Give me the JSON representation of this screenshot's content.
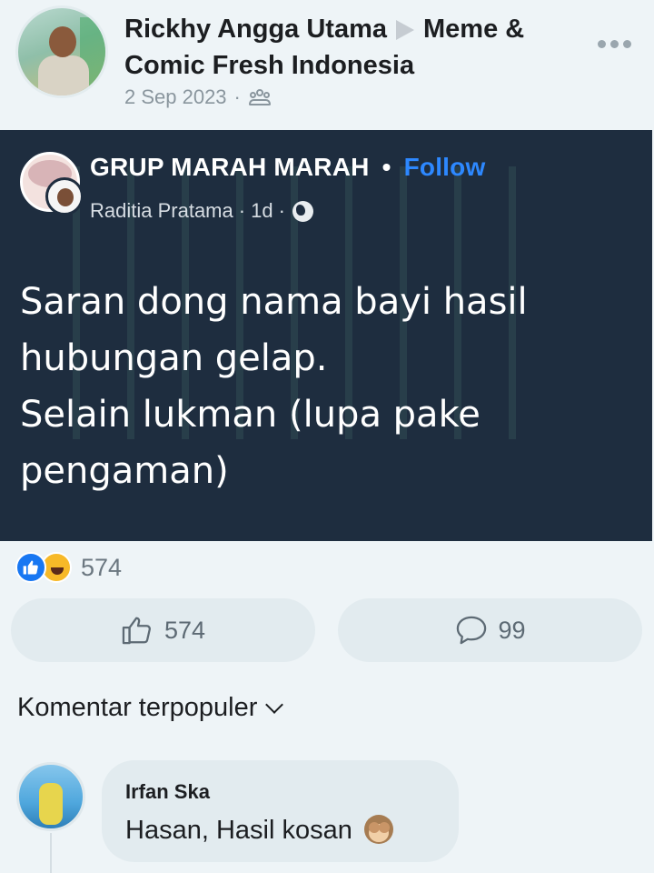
{
  "post": {
    "author": "Rickhy Angga Utama",
    "group": "Meme & Comic Fresh Indonesia",
    "date": "2 Sep 2023",
    "meta_separator": "·"
  },
  "shared": {
    "group_name": "GRUP MARAH MARAH",
    "dot": "•",
    "follow_label": "Follow",
    "poster": "Raditia Pratama",
    "separator": "·",
    "time": "1d",
    "text": "Saran dong nama bayi hasil\nhubungan gelap.\nSelain lukman (lupa pake\npengaman)"
  },
  "reactions": {
    "count": "574",
    "icons": [
      "like-icon",
      "haha-icon"
    ]
  },
  "actions": {
    "like_count": "574",
    "comment_count": "99"
  },
  "comments": {
    "sort_label": "Komentar terpopuler",
    "items": [
      {
        "author": "Irfan Ska",
        "text": "Hasan, Hasil kosan",
        "emoji": "see-no-evil-monkey-icon"
      }
    ]
  },
  "colors": {
    "background": "#eef4f7",
    "card": "#1e2d3f",
    "follow": "#2d88ff",
    "like_blue": "#1877f2",
    "haha_yellow": "#f7b928",
    "button_bg": "#e2ebef"
  }
}
